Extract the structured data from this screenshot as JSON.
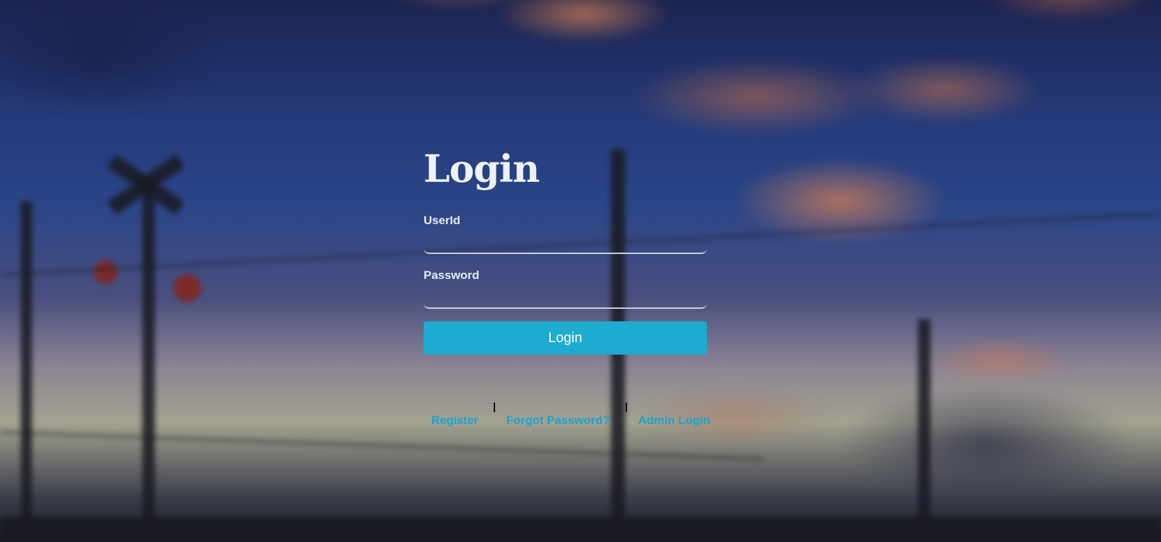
{
  "login": {
    "title": "Login",
    "userid_label": "UserId",
    "userid_value": "",
    "password_label": "Password",
    "password_value": "",
    "submit_label": "Login"
  },
  "links": {
    "register": "Register",
    "forgot_password": "Forgot Password?",
    "admin_login": "Admin Login"
  },
  "colors": {
    "accent": "#1eabd0",
    "link": "#1aa3cf",
    "title_text": "#eef2f6"
  }
}
